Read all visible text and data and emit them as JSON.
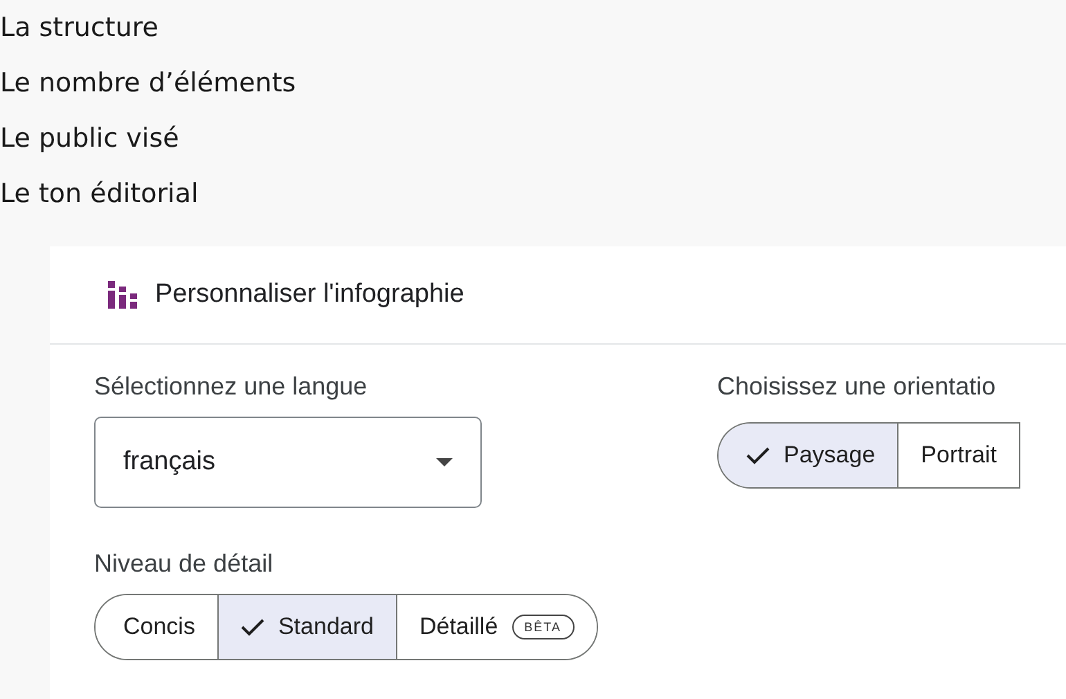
{
  "criteria": [
    "La structure",
    "Le nombre d’éléments",
    "Le public visé",
    "Le ton éditorial"
  ],
  "dialog": {
    "title": "Personnaliser l'infographie",
    "language": {
      "label": "Sélectionnez une langue",
      "value": "français"
    },
    "orientation": {
      "label": "Choisissez une orientatio",
      "options": [
        {
          "label": "Paysage",
          "selected": true
        },
        {
          "label": "Portrait",
          "selected": false
        }
      ]
    },
    "detail": {
      "label": "Niveau de détail",
      "options": [
        {
          "label": "Concis",
          "selected": false
        },
        {
          "label": "Standard",
          "selected": true
        },
        {
          "label": "Détaillé",
          "selected": false,
          "badge": "BÊTA"
        }
      ]
    }
  }
}
